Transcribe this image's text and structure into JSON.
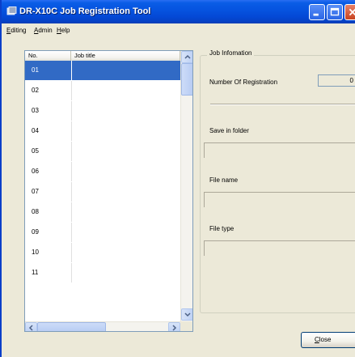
{
  "window": {
    "title": "DR-X10C Job Registration Tool"
  },
  "menu": {
    "items": [
      {
        "label": "Editing",
        "accel": "E",
        "rest": "diting"
      },
      {
        "label": "Admin",
        "accel": "A",
        "rest": "dmin"
      },
      {
        "label": "Help",
        "accel": "H",
        "rest": "elp"
      }
    ]
  },
  "list": {
    "columns": [
      "No.",
      "Job title"
    ],
    "rows": [
      {
        "no": "01",
        "title": "",
        "selected": true
      },
      {
        "no": "02",
        "title": ""
      },
      {
        "no": "03",
        "title": ""
      },
      {
        "no": "04",
        "title": ""
      },
      {
        "no": "05",
        "title": ""
      },
      {
        "no": "06",
        "title": ""
      },
      {
        "no": "07",
        "title": ""
      },
      {
        "no": "08",
        "title": ""
      },
      {
        "no": "09",
        "title": ""
      },
      {
        "no": "10",
        "title": ""
      },
      {
        "no": "11",
        "title": ""
      }
    ]
  },
  "job_info": {
    "group_title": "Job Infomation",
    "registration_label": "Number Of Registration",
    "registration_count": "0",
    "save_folder_label": "Save in folder",
    "save_folder_value": "",
    "file_name_label": "File name",
    "file_name_value": "",
    "file_type_label": "File type",
    "file_type_value": ""
  },
  "buttons": {
    "close_accel": "C",
    "close_rest": "lose"
  },
  "colors": {
    "title_bar": "#0654e0",
    "selection": "#316ac5",
    "window_bg": "#ece9d8"
  }
}
